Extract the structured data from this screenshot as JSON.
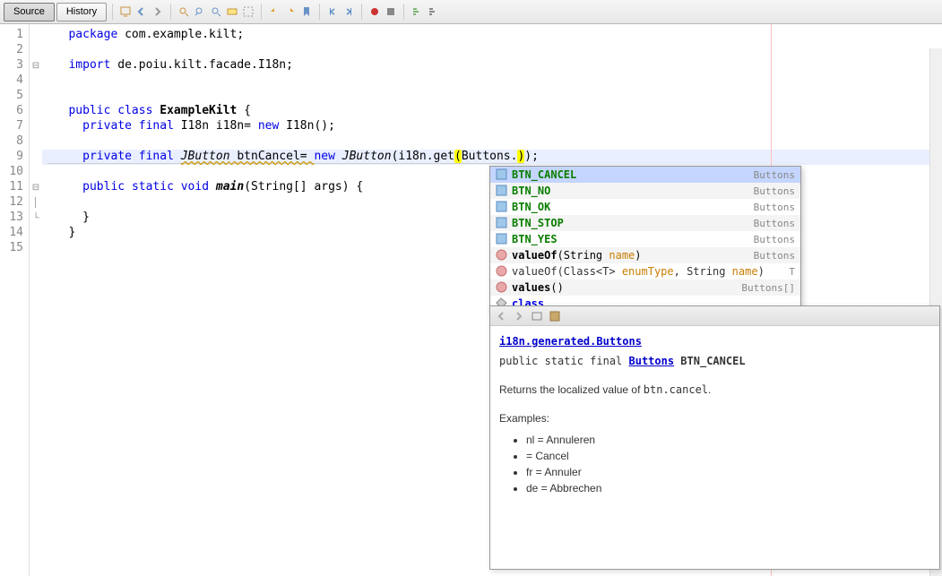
{
  "tabs": {
    "source": "Source",
    "history": "History"
  },
  "gutter_lines": [
    "1",
    "2",
    "3",
    "4",
    "5",
    "6",
    "7",
    "8",
    "9",
    "10",
    "11",
    "12",
    "13",
    "14",
    "15"
  ],
  "code": {
    "l1": {
      "kw": "package",
      "rest": " com.example.kilt;"
    },
    "l3": {
      "kw": "import",
      "rest": " de.poiu.kilt.facade.I18n;"
    },
    "l6": {
      "kw1": "public",
      "kw2": "class",
      "name": "ExampleKilt",
      "brace": " {"
    },
    "l7": {
      "kw1": "private",
      "kw2": "final",
      "type": "I18n",
      "var": " i18n= ",
      "kw3": "new",
      "ctor": " I18n();"
    },
    "l9": {
      "kw1": "private",
      "kw2": "final",
      "type": "JButton",
      "var": " btnCancel= ",
      "kw3": "new",
      "ctor": "JButton",
      "call": "(i18n.get",
      "paren1": "(",
      "arg": "Buttons.",
      "paren2": ")",
      "end": ");"
    },
    "l11": {
      "kw1": "public",
      "kw2": "static",
      "kw3": "void",
      "name": "main",
      "params": "(String[] args) {"
    },
    "l13": "  }",
    "l14": "}"
  },
  "popup": [
    {
      "label": "BTN_CANCEL",
      "type": "Buttons",
      "icon": "enum",
      "green": true,
      "selected": true
    },
    {
      "label": "BTN_NO",
      "type": "Buttons",
      "icon": "enum",
      "green": true,
      "alt": true
    },
    {
      "label": "BTN_OK",
      "type": "Buttons",
      "icon": "enum",
      "green": true
    },
    {
      "label": "BTN_STOP",
      "type": "Buttons",
      "icon": "enum",
      "green": true,
      "alt": true
    },
    {
      "label": "BTN_YES",
      "type": "Buttons",
      "icon": "enum",
      "green": true
    },
    {
      "label_pre": "valueOf",
      "label_params": "(String ",
      "param_name": "name",
      "label_post": ")",
      "type": "Buttons",
      "icon": "method",
      "alt": true
    },
    {
      "label_pre": "valueOf",
      "label_params": "(Class<T> ",
      "param_name": "enumType",
      "label_mid": ", String ",
      "param_name2": "name",
      "label_post": ")",
      "type": "T",
      "icon": "method-i",
      "plain": true
    },
    {
      "label_pre": "values",
      "label_post": "()",
      "type": "Buttons[]",
      "icon": "method",
      "alt": true
    },
    {
      "label": "class",
      "type": "",
      "icon": "class",
      "kw": true
    }
  ],
  "doc": {
    "pkg": "i18n.generated.Buttons",
    "sig_pre": "public static final ",
    "sig_type": "Buttons",
    "sig_name": " BTN_CANCEL",
    "desc_pre": "Returns the localized value of ",
    "desc_code": "btn.cancel",
    "desc_post": ".",
    "examples_label": "Examples:",
    "examples": [
      "nl = Annuleren",
      "= Cancel",
      "fr = Annuler",
      "de = Abbrechen"
    ]
  }
}
